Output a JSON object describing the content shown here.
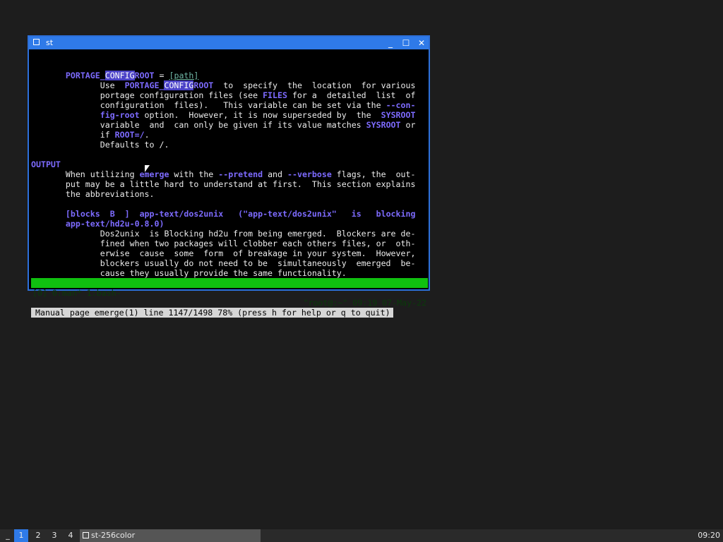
{
  "window": {
    "title": "st",
    "controls": {
      "minimize": "_",
      "maximize": "☐",
      "close": "✕"
    }
  },
  "terminal": {
    "lines": [
      [
        {
          "t": "       "
        },
        {
          "t": "PORTAGE_",
          "c": "b"
        },
        {
          "t": "CONFIG",
          "c": "hl"
        },
        {
          "t": "ROOT",
          "c": "b"
        },
        {
          "t": " = "
        },
        {
          "t": "[path]",
          "c": "ul"
        }
      ],
      [
        {
          "t": "              Use  "
        },
        {
          "t": "PORTAGE_",
          "c": "b"
        },
        {
          "t": "CONFIG",
          "c": "hl"
        },
        {
          "t": "ROOT",
          "c": "b"
        },
        {
          "t": "  to  specify  the  location  for various"
        }
      ],
      [
        {
          "t": "              portage configuration files (see "
        },
        {
          "t": "FILES",
          "c": "b"
        },
        {
          "t": " for a  detailed  list  of"
        }
      ],
      [
        {
          "t": "              configuration  files).   This variable can be set via the "
        },
        {
          "t": "--con-",
          "c": "b"
        }
      ],
      [
        {
          "t": "              "
        },
        {
          "t": "fig-root",
          "c": "b"
        },
        {
          "t": " option.  However, it is now superseded by  the  "
        },
        {
          "t": "SYSROOT",
          "c": "b"
        }
      ],
      [
        {
          "t": "              variable  and  can only be given if its value matches "
        },
        {
          "t": "SYSROOT",
          "c": "b"
        },
        {
          "t": " or"
        }
      ],
      [
        {
          "t": "              if "
        },
        {
          "t": "ROOT=/",
          "c": "b"
        },
        {
          "t": "."
        }
      ],
      [
        {
          "t": "              Defaults to /."
        }
      ],
      [
        {
          "t": ""
        }
      ],
      [
        {
          "t": "OUTPUT",
          "c": "b"
        }
      ],
      [
        {
          "t": "       When utilizing "
        },
        {
          "t": "emerge",
          "c": "b"
        },
        {
          "t": " with the "
        },
        {
          "t": "--pretend",
          "c": "b"
        },
        {
          "t": " and "
        },
        {
          "t": "--verbose",
          "c": "b"
        },
        {
          "t": " flags, the  out-"
        }
      ],
      [
        {
          "t": "       put may be a little hard to understand at first.  This section explains"
        }
      ],
      [
        {
          "t": "       the abbreviations."
        }
      ],
      [
        {
          "t": ""
        }
      ],
      [
        {
          "t": "       "
        },
        {
          "t": "[blocks  B  ]  app-text/dos2unix   (\"app-text/dos2unix\"   is   blocking",
          "c": "b"
        }
      ],
      [
        {
          "t": "       "
        },
        {
          "t": "app-text/hd2u-0.8.0)",
          "c": "b"
        }
      ],
      [
        {
          "t": "              Dos2unix  is Blocking hd2u from being emerged.  Blockers are de-"
        }
      ],
      [
        {
          "t": "              fined when two packages will clobber each others files, or  oth-"
        }
      ],
      [
        {
          "t": "              erwise  cause  some  form  of breakage in your system.  However,"
        }
      ],
      [
        {
          "t": "              blockers usually do not need to be  simultaneously  emerged  be-"
        }
      ],
      [
        {
          "t": "              cause they usually provide the same functionality."
        }
      ],
      [
        {
          "t": ""
        }
      ]
    ],
    "status_line": "Manual page emerge(1) line 1147/1498 78% (press h for help or q to quit)",
    "tmux": {
      "left": "[0] 0:man* 1:bash-",
      "right": "\"root@:~\" 09:19 07-May-22"
    }
  },
  "taskbar": {
    "launcher": "_",
    "workspaces": [
      "1",
      "2",
      "3",
      "4"
    ],
    "active_workspace": "1",
    "task_label": "st-256color",
    "clock": "09:20"
  }
}
